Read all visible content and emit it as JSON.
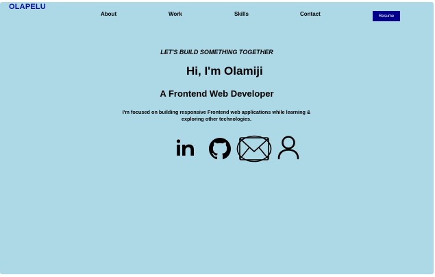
{
  "header": {
    "logo": "OLAPELU",
    "nav": [
      "About",
      "Work",
      "Skills",
      "Contact"
    ],
    "resume_label": "Resume"
  },
  "hero": {
    "tagline": "LET'S BUILD SOMETHING TOGETHER",
    "greeting": "Hi, I'm Olamiji",
    "role": "A Frontend Web Developer",
    "description": "I'm focused on building responsive Frontend web applications while learning & exploring other technologies."
  },
  "social_icons": [
    "linkedin-icon",
    "github-icon",
    "email-icon",
    "profile-icon"
  ],
  "colors": {
    "background": "#add8e6",
    "logo": "#0a0aa0",
    "button": "#00008b"
  }
}
